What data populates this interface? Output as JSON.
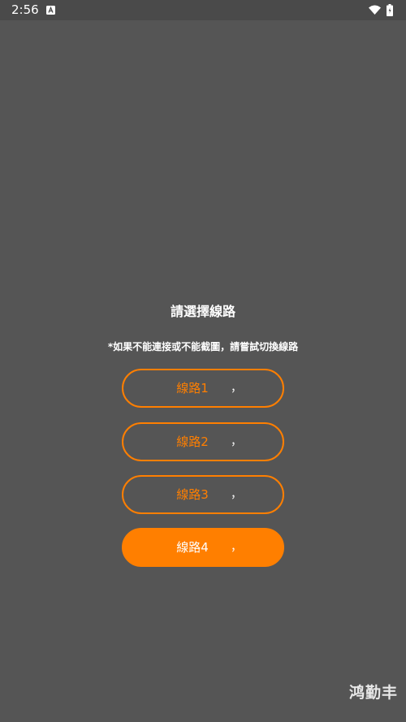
{
  "status_bar": {
    "time": "2:56",
    "app_icon": "a-icon",
    "wifi_icon": "wifi-icon",
    "battery_icon": "battery-icon"
  },
  "dialog": {
    "title": "請選擇線路",
    "notice": "*如果不能連接或不能截圖，請嘗試切換線路",
    "routes": [
      {
        "label": "線路1",
        "mark": "，",
        "selected": false
      },
      {
        "label": "線路2",
        "mark": "，",
        "selected": false
      },
      {
        "label": "線路3",
        "mark": "，",
        "selected": false
      },
      {
        "label": "線路4",
        "mark": "，",
        "selected": true
      }
    ]
  },
  "watermark": "鸿勤丰",
  "colors": {
    "background": "#555555",
    "accent": "#ff7f00",
    "text": "#ffffff"
  }
}
